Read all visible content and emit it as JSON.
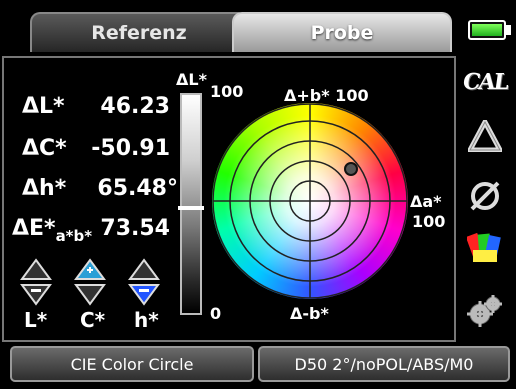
{
  "tabs": {
    "referenz": "Referenz",
    "probe": "Probe"
  },
  "readouts": {
    "dL": {
      "label": "ΔL*",
      "value": "46.23"
    },
    "dC": {
      "label": "ΔC*",
      "value": "-50.91"
    },
    "dh": {
      "label": "Δh*",
      "value": "65.48°"
    },
    "dE": {
      "label": "ΔE*",
      "sub": "a*b*",
      "value": "73.54"
    }
  },
  "selectors": {
    "l": "L*",
    "c": "C*",
    "h": "h*"
  },
  "lbar": {
    "title": "ΔL*",
    "max": "100",
    "min": "0",
    "level": 0.48
  },
  "circle": {
    "top": "Δ+b* 100",
    "bottom": "Δ-b*",
    "right1": "Δa*",
    "right2": "100"
  },
  "bottom": {
    "left": "CIE Color Circle",
    "right": "D50 2°/noPOL/ABS/M0"
  },
  "icons": {
    "cal": "CAL"
  },
  "colors": {
    "selected": "#2255ff",
    "battery": "#3fd43f"
  }
}
